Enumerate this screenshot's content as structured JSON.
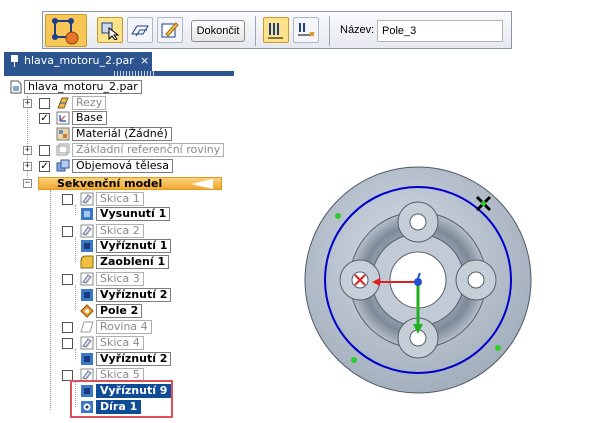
{
  "commandbar": {
    "finish_label": "Dokončit",
    "name_label": "Název:",
    "name_value": "Pole_3",
    "buttons": [
      "pattern-feature-icon",
      "select-geometry-icon",
      "profile-plane-icon",
      "draw-sketch-icon",
      "fill-pattern-icon",
      "count-spacing-icon"
    ]
  },
  "tab": {
    "title": "hlava_motoru_2.par",
    "close": "×"
  },
  "tree": {
    "root": "hlava_motoru_2.par",
    "rezy": "Řezy",
    "base": "Base",
    "material": "Materiál (Žádné)",
    "ref_planes": "Základní referenční roviny",
    "bodies": "Objemová tělesa",
    "sequential": "Sekvenční model",
    "skica1": "Skica 1",
    "vysunuti1": "Vysunutí 1",
    "skica2": "Skica 2",
    "vyriznuti1": "Vyříznutí 1",
    "zaobleni1": "Zaoblení 1",
    "skica3": "Skica 3",
    "vyriznuti2": "Vyříznutí 2",
    "pole2": "Pole 2",
    "rovina4": "Rovina 4",
    "skica4": "Skica 4",
    "vyriznuti2b": "Vyříznutí 2",
    "skica5": "Skica 5",
    "vyriznuti9": "Vyříznutí 9",
    "dira1": "Díra 1"
  },
  "colors": {
    "accent": "#2c5590",
    "selection": "#0f4c97",
    "sequential_bar": "#f2a832",
    "highlight_box": "#e0505a",
    "pattern_circle": "#0000cc",
    "keypoint": "#2ecc2e"
  }
}
